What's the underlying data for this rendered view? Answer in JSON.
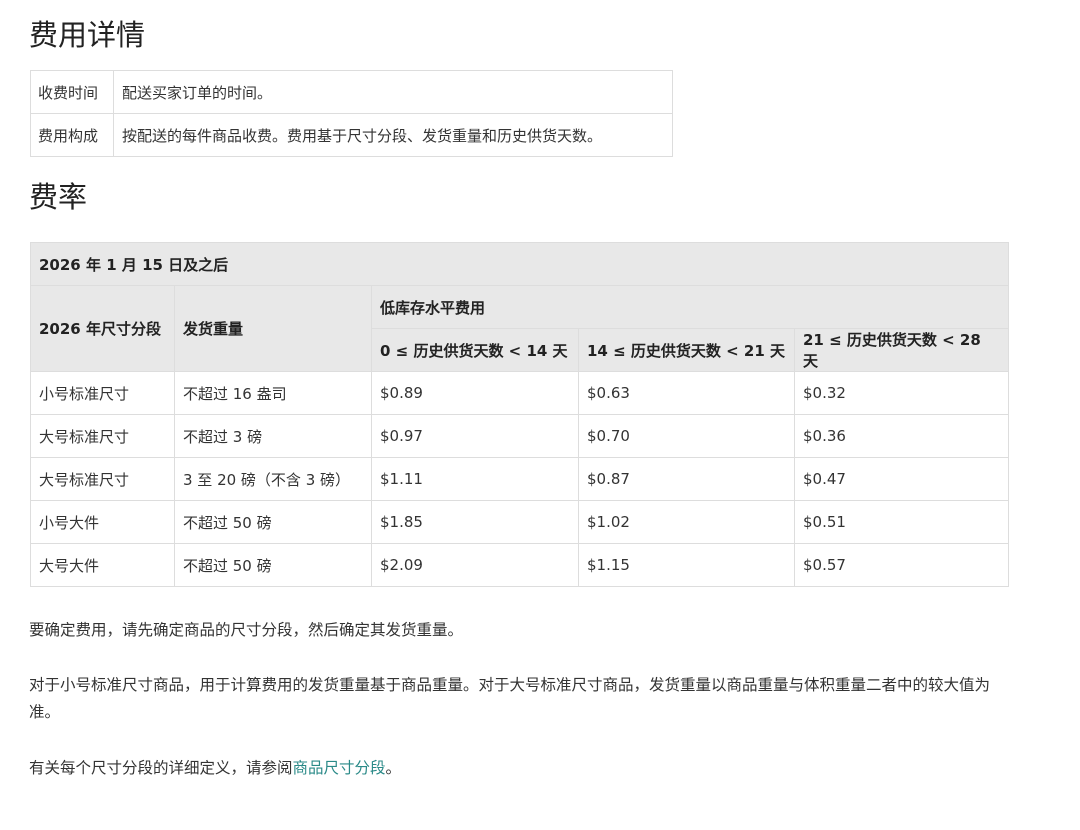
{
  "title": "费用详情",
  "details": [
    {
      "label": "收费时间",
      "value": "配送买家订单的时间。"
    },
    {
      "label": "费用构成",
      "value": "按配送的每件商品收费。费用基于尺寸分段、发货重量和历史供货天数。"
    }
  ],
  "rates_title": "费率",
  "rates": {
    "caption": "2026 年 1 月 15 日及之后",
    "col_tier": "2026 年尺寸分段",
    "col_weight": "发货重量",
    "col_group": "低库存水平费用",
    "col_ranges": [
      "0 ≤ 历史供货天数 < 14 天",
      "14 ≤ 历史供货天数 < 21 天",
      "21 ≤ 历史供货天数 < 28 天"
    ],
    "rows": [
      {
        "tier": "小号标准尺寸",
        "weight": "不超过 16 盎司",
        "fees": [
          "$0.89",
          "$0.63",
          "$0.32"
        ]
      },
      {
        "tier": "大号标准尺寸",
        "weight": "不超过 3 磅",
        "fees": [
          "$0.97",
          "$0.70",
          "$0.36"
        ]
      },
      {
        "tier": "大号标准尺寸",
        "weight": "3 至 20 磅（不含 3 磅）",
        "fees": [
          "$1.11",
          "$0.87",
          "$0.47"
        ]
      },
      {
        "tier": "小号大件",
        "weight": "不超过 50 磅",
        "fees": [
          "$1.85",
          "$1.02",
          "$0.51"
        ]
      },
      {
        "tier": "大号大件",
        "weight": "不超过 50 磅",
        "fees": [
          "$2.09",
          "$1.15",
          "$0.57"
        ]
      }
    ]
  },
  "notes": {
    "p1": "要确定费用，请先确定商品的尺寸分段，然后确定其发货重量。",
    "p2": "对于小号标准尺寸商品，用于计算费用的发货重量基于商品重量。对于大号标准尺寸商品，发货重量以商品重量与体积重量二者中的较大值为准。",
    "p3_prefix": "有关每个尺寸分段的详细定义，请参阅",
    "p3_link": "商品尺寸分段",
    "p3_suffix": "。"
  }
}
